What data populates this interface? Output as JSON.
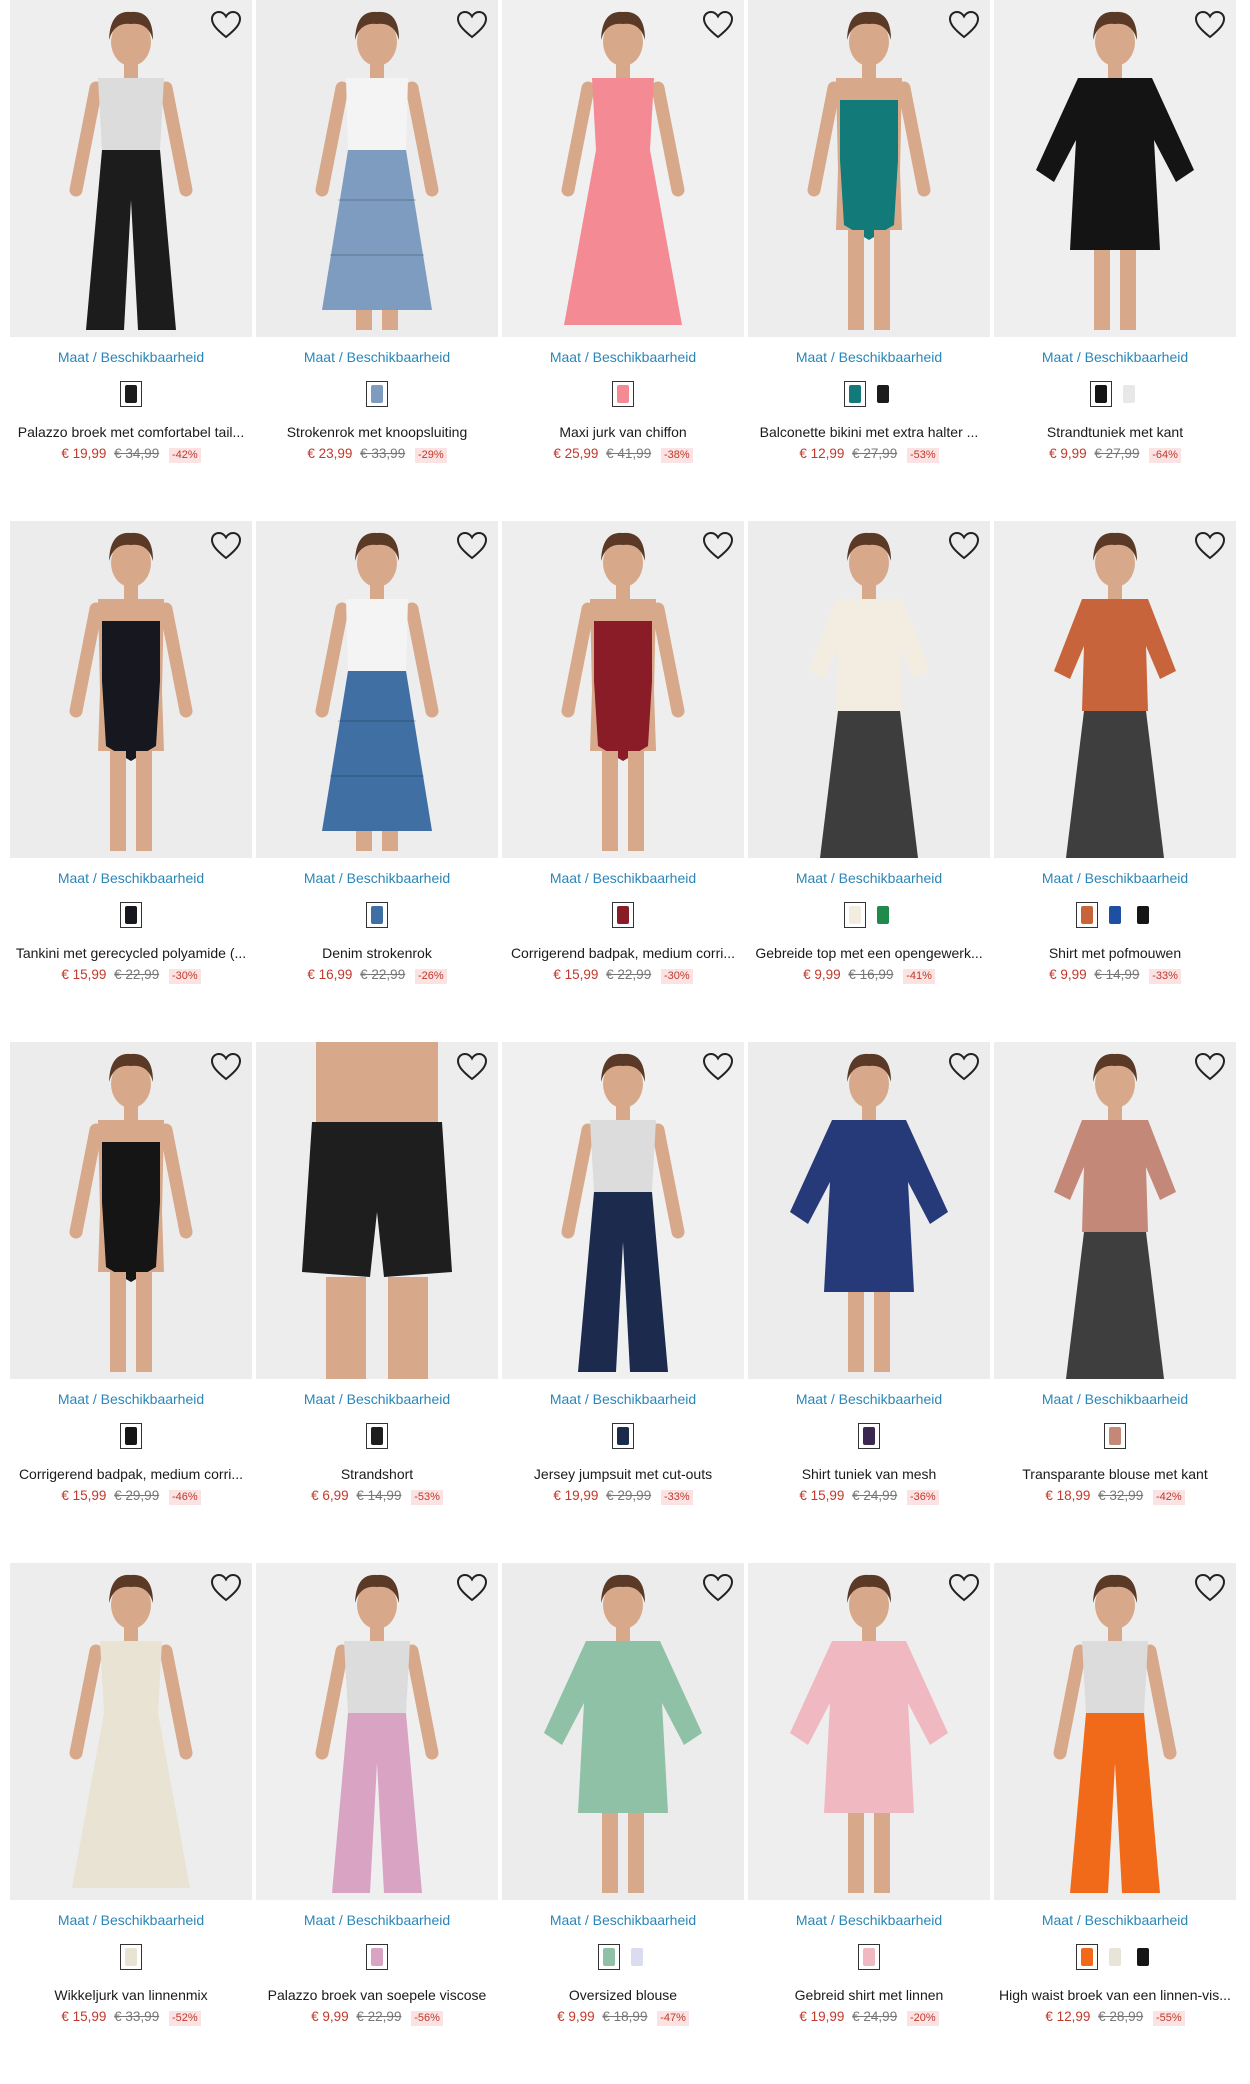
{
  "product_grid": {
    "size_label": "Maat / Beschikbaarheid",
    "products": [
      {
        "title": "Palazzo broek met comfortabel tail...",
        "price": "€ 19,99",
        "old_price": "€ 34,99",
        "discount": "-42%",
        "bg": "#eeeeee",
        "garment": "#1c1c1c",
        "figure": "pants",
        "swatches": [
          "#1c1c1c"
        ]
      },
      {
        "title": "Strokenrok met knoopsluiting",
        "price": "€ 23,99",
        "old_price": "€ 33,99",
        "discount": "-29%",
        "bg": "#ececec",
        "garment": "#7d9cc0",
        "figure": "skirt",
        "swatches": [
          "#7d9cc0"
        ]
      },
      {
        "title": "Maxi jurk van chiffon",
        "price": "€ 25,99",
        "old_price": "€ 41,99",
        "discount": "-38%",
        "bg": "#f0f0f0",
        "garment": "#f48a94",
        "figure": "dress",
        "swatches": [
          "#f48a94"
        ]
      },
      {
        "title": "Balconette bikini met extra halter ...",
        "price": "€ 12,99",
        "old_price": "€ 27,99",
        "discount": "-53%",
        "bg": "#ededed",
        "garment": "#137a7a",
        "figure": "swim",
        "swatches": [
          "#137a7a",
          "#1c1c1c"
        ]
      },
      {
        "title": "Strandtuniek met kant",
        "price": "€ 9,99",
        "old_price": "€ 27,99",
        "discount": "-64%",
        "bg": "#efefef",
        "garment": "#141414",
        "figure": "tunic",
        "swatches": [
          "#141414",
          "#e8e8e8"
        ]
      },
      {
        "title": "Tankini met gerecycled polyamide (...",
        "price": "€ 15,99",
        "old_price": "€ 22,99",
        "discount": "-30%",
        "bg": "#ececec",
        "garment": "#17171f",
        "figure": "swim",
        "swatches": [
          "#17171f"
        ]
      },
      {
        "title": "Denim strokenrok",
        "price": "€ 16,99",
        "old_price": "€ 22,99",
        "discount": "-26%",
        "bg": "#ededed",
        "garment": "#3f6fa3",
        "figure": "skirt",
        "swatches": [
          "#3f6fa3"
        ]
      },
      {
        "title": "Corrigerend badpak, medium corri...",
        "price": "€ 15,99",
        "old_price": "€ 22,99",
        "discount": "-30%",
        "bg": "#eeeeee",
        "garment": "#8a1c28",
        "figure": "swim",
        "swatches": [
          "#8a1c28"
        ]
      },
      {
        "title": "Gebreide top met een opengewerk...",
        "price": "€ 9,99",
        "old_price": "€ 16,99",
        "discount": "-41%",
        "bg": "#ececec",
        "garment": "#f3ece0",
        "figure": "top",
        "swatches": [
          "#f3ece0",
          "#1f8a4c"
        ]
      },
      {
        "title": "Shirt met pofmouwen",
        "price": "€ 9,99",
        "old_price": "€ 14,99",
        "discount": "-33%",
        "bg": "#eeeeee",
        "garment": "#c8643c",
        "figure": "top",
        "swatches": [
          "#c8643c",
          "#1d4fa3",
          "#151515"
        ]
      },
      {
        "title": "Corrigerend badpak, medium corri...",
        "price": "€ 15,99",
        "old_price": "€ 29,99",
        "discount": "-46%",
        "bg": "#ececec",
        "garment": "#151515",
        "figure": "swim",
        "swatches": [
          "#151515"
        ]
      },
      {
        "title": "Strandshort",
        "price": "€ 6,99",
        "old_price": "€ 14,99",
        "discount": "-53%",
        "bg": "#ededed",
        "garment": "#1e1e1e",
        "figure": "shorts",
        "swatches": [
          "#1e1e1e"
        ]
      },
      {
        "title": "Jersey jumpsuit met cut-outs",
        "price": "€ 19,99",
        "old_price": "€ 29,99",
        "discount": "-33%",
        "bg": "#f0f0f0",
        "garment": "#1c2a4d",
        "figure": "pants",
        "swatches": [
          "#1c2a4d"
        ]
      },
      {
        "title": "Shirt tuniek van mesh",
        "price": "€ 15,99",
        "old_price": "€ 24,99",
        "discount": "-36%",
        "bg": "#ececec",
        "garment": "#263a7a",
        "figure": "tunic",
        "swatches": [
          "#3a2850"
        ]
      },
      {
        "title": "Transparante blouse met kant",
        "price": "€ 18,99",
        "old_price": "€ 32,99",
        "discount": "-42%",
        "bg": "#eeeeee",
        "garment": "#c48878",
        "figure": "top",
        "swatches": [
          "#c48878"
        ]
      },
      {
        "title": "Wikkeljurk van linnenmix",
        "price": "€ 15,99",
        "old_price": "€ 33,99",
        "discount": "-52%",
        "bg": "#ededed",
        "garment": "#e9e3d3",
        "figure": "dress",
        "swatches": [
          "#e9e3d3"
        ]
      },
      {
        "title": "Palazzo broek van soepele viscose",
        "price": "€ 9,99",
        "old_price": "€ 22,99",
        "discount": "-56%",
        "bg": "#efefef",
        "garment": "#d9a4c4",
        "figure": "pants",
        "swatches": [
          "#d9a4c4"
        ]
      },
      {
        "title": "Oversized blouse",
        "price": "€ 9,99",
        "old_price": "€ 18,99",
        "discount": "-47%",
        "bg": "#ececec",
        "garment": "#8fc1a6",
        "figure": "tunic",
        "swatches": [
          "#8fc1a6",
          "#dcdcf0"
        ]
      },
      {
        "title": "Gebreid shirt met linnen",
        "price": "€ 19,99",
        "old_price": "€ 24,99",
        "discount": "-20%",
        "bg": "#eeeeee",
        "garment": "#f0b8c0",
        "figure": "tunic",
        "swatches": [
          "#f0b8c0"
        ]
      },
      {
        "title": "High waist broek van een linnen-vis...",
        "price": "€ 12,99",
        "old_price": "€ 28,99",
        "discount": "-55%",
        "bg": "#ededed",
        "garment": "#f06a1a",
        "figure": "pants",
        "swatches": [
          "#f06a1a",
          "#e8e4d8",
          "#151515"
        ]
      }
    ]
  }
}
